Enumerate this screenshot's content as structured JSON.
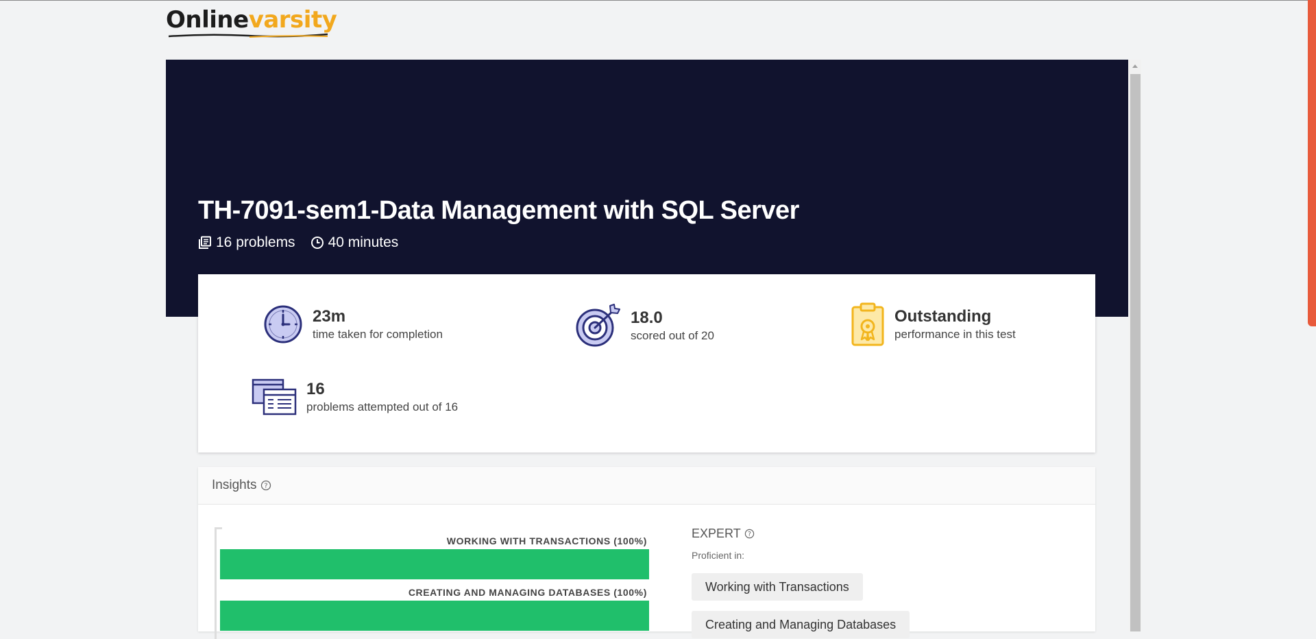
{
  "brand": {
    "part1": "Online",
    "part2": "varsity"
  },
  "test": {
    "title": "TH-7091-sem1-Data Management with SQL Server",
    "problems": "16 problems",
    "duration": "40 minutes"
  },
  "stats": [
    {
      "value": "23m",
      "label": "time taken for completion",
      "icon": "clock-icon"
    },
    {
      "value": "18.0",
      "label": "scored out of 20",
      "icon": "target-icon"
    },
    {
      "value": "Outstanding",
      "label": "performance in this test",
      "icon": "certificate-icon"
    },
    {
      "value": "16",
      "label": "problems attempted out of 16",
      "icon": "problems-icon"
    }
  ],
  "insights": {
    "heading": "Insights",
    "bars": [
      {
        "label": "WORKING WITH TRANSACTIONS (100%)",
        "percent": 100
      },
      {
        "label": "CREATING AND MANAGING DATABASES (100%)",
        "percent": 100
      }
    ],
    "level": "EXPERT",
    "proficient_label": "Proficient in:",
    "tags": [
      "Working with Transactions",
      "Creating and Managing Databases"
    ]
  },
  "colors": {
    "hero_bg": "#11132e",
    "bar_green": "#20bf6b",
    "icon_navy": "#2b2f7a",
    "icon_lavender": "#c9cbf2",
    "icon_gold": "#f2b51d",
    "scroll_accent": "#e85a3b"
  }
}
